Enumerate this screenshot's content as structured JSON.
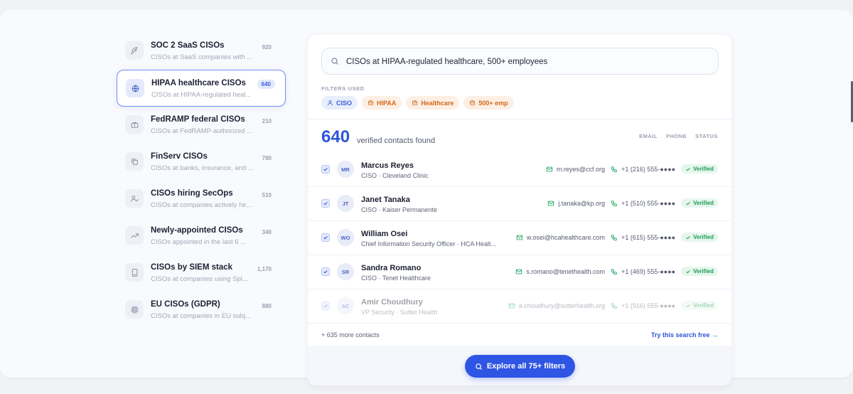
{
  "sidebar": {
    "items": [
      {
        "title": "SOC 2 SaaS CISOs",
        "subtitle": "CISOs at SaaS companies with ...",
        "count": "920",
        "icon": "rocket-icon",
        "active": false
      },
      {
        "title": "HIPAA healthcare CISOs",
        "subtitle": "CISOs at HIPAA-regulated heal...",
        "count": "640",
        "icon": "globe-icon",
        "active": true
      },
      {
        "title": "FedRAMP federal CISOs",
        "subtitle": "CISOs at FedRAMP-authorized ...",
        "count": "210",
        "icon": "briefcase-icon",
        "active": false
      },
      {
        "title": "FinServ CISOs",
        "subtitle": "CISOs at banks, insurance, and ...",
        "count": "780",
        "icon": "copy-icon",
        "active": false
      },
      {
        "title": "CISOs hiring SecOps",
        "subtitle": "CISOs at companies actively hir...",
        "count": "510",
        "icon": "user-check-icon",
        "active": false
      },
      {
        "title": "Newly-appointed CISOs",
        "subtitle": "CISOs appointed in the last 6 ...",
        "count": "340",
        "icon": "trending-up-icon",
        "active": false
      },
      {
        "title": "CISOs by SIEM stack",
        "subtitle": "CISOs at companies using Spl...",
        "count": "1,170",
        "icon": "server-icon",
        "active": false
      },
      {
        "title": "EU CISOs (GDPR)",
        "subtitle": "CISOs at companies in EU subj...",
        "count": "880",
        "icon": "cpu-icon",
        "active": false
      }
    ]
  },
  "search": {
    "value": "CISOs at HIPAA-regulated healthcare, 500+ employees"
  },
  "filters": {
    "label": "FILTERS USED",
    "chips": [
      {
        "label": "CISO",
        "icon": "user-icon",
        "tone": "blue"
      },
      {
        "label": "HIPAA",
        "icon": "building-icon",
        "tone": "orange"
      },
      {
        "label": "Healthcare",
        "icon": "building-icon",
        "tone": "orange"
      },
      {
        "label": "500+ emp",
        "icon": "building-icon",
        "tone": "orange"
      }
    ]
  },
  "results": {
    "count": "640",
    "count_label": "verified contacts found",
    "columns": [
      "EMAIL",
      "PHONE",
      "STATUS"
    ],
    "contacts": [
      {
        "initials": "MR",
        "name": "Marcus Reyes",
        "role": "CISO · Cleveland Clinic",
        "email": "m.reyes@ccf.org",
        "phone": "+1 (216) 555-●●●●",
        "status": "Verified"
      },
      {
        "initials": "JT",
        "name": "Janet Tanaka",
        "role": "CISO · Kaiser Permanente",
        "email": "j.tanaka@kp.org",
        "phone": "+1 (510) 555-●●●●",
        "status": "Verified"
      },
      {
        "initials": "WO",
        "name": "William Osei",
        "role": "Chief Information Security Officer · HCA Healt...",
        "email": "w.osei@hcahealthcare.com",
        "phone": "+1 (615) 555-●●●●",
        "status": "Verified"
      },
      {
        "initials": "SR",
        "name": "Sandra Romano",
        "role": "CISO · Tenet Healthcare",
        "email": "s.romano@tenethealth.com",
        "phone": "+1 (469) 555-●●●●",
        "status": "Verified"
      },
      {
        "initials": "AC",
        "name": "Amir Choudhury",
        "role": "VP Security · Sutter Health",
        "email": "a.choudhury@sutterhealth.org",
        "phone": "+1 (916) 555-●●●●",
        "status": "Verified"
      }
    ],
    "more": "+ 635 more contacts",
    "try_link": "Try this search free →"
  },
  "cta": {
    "label": "Explore all 75+ filters"
  },
  "colors": {
    "accent": "#2f55e4",
    "verified": "#1f9a58",
    "orange": "#d06a1e"
  }
}
